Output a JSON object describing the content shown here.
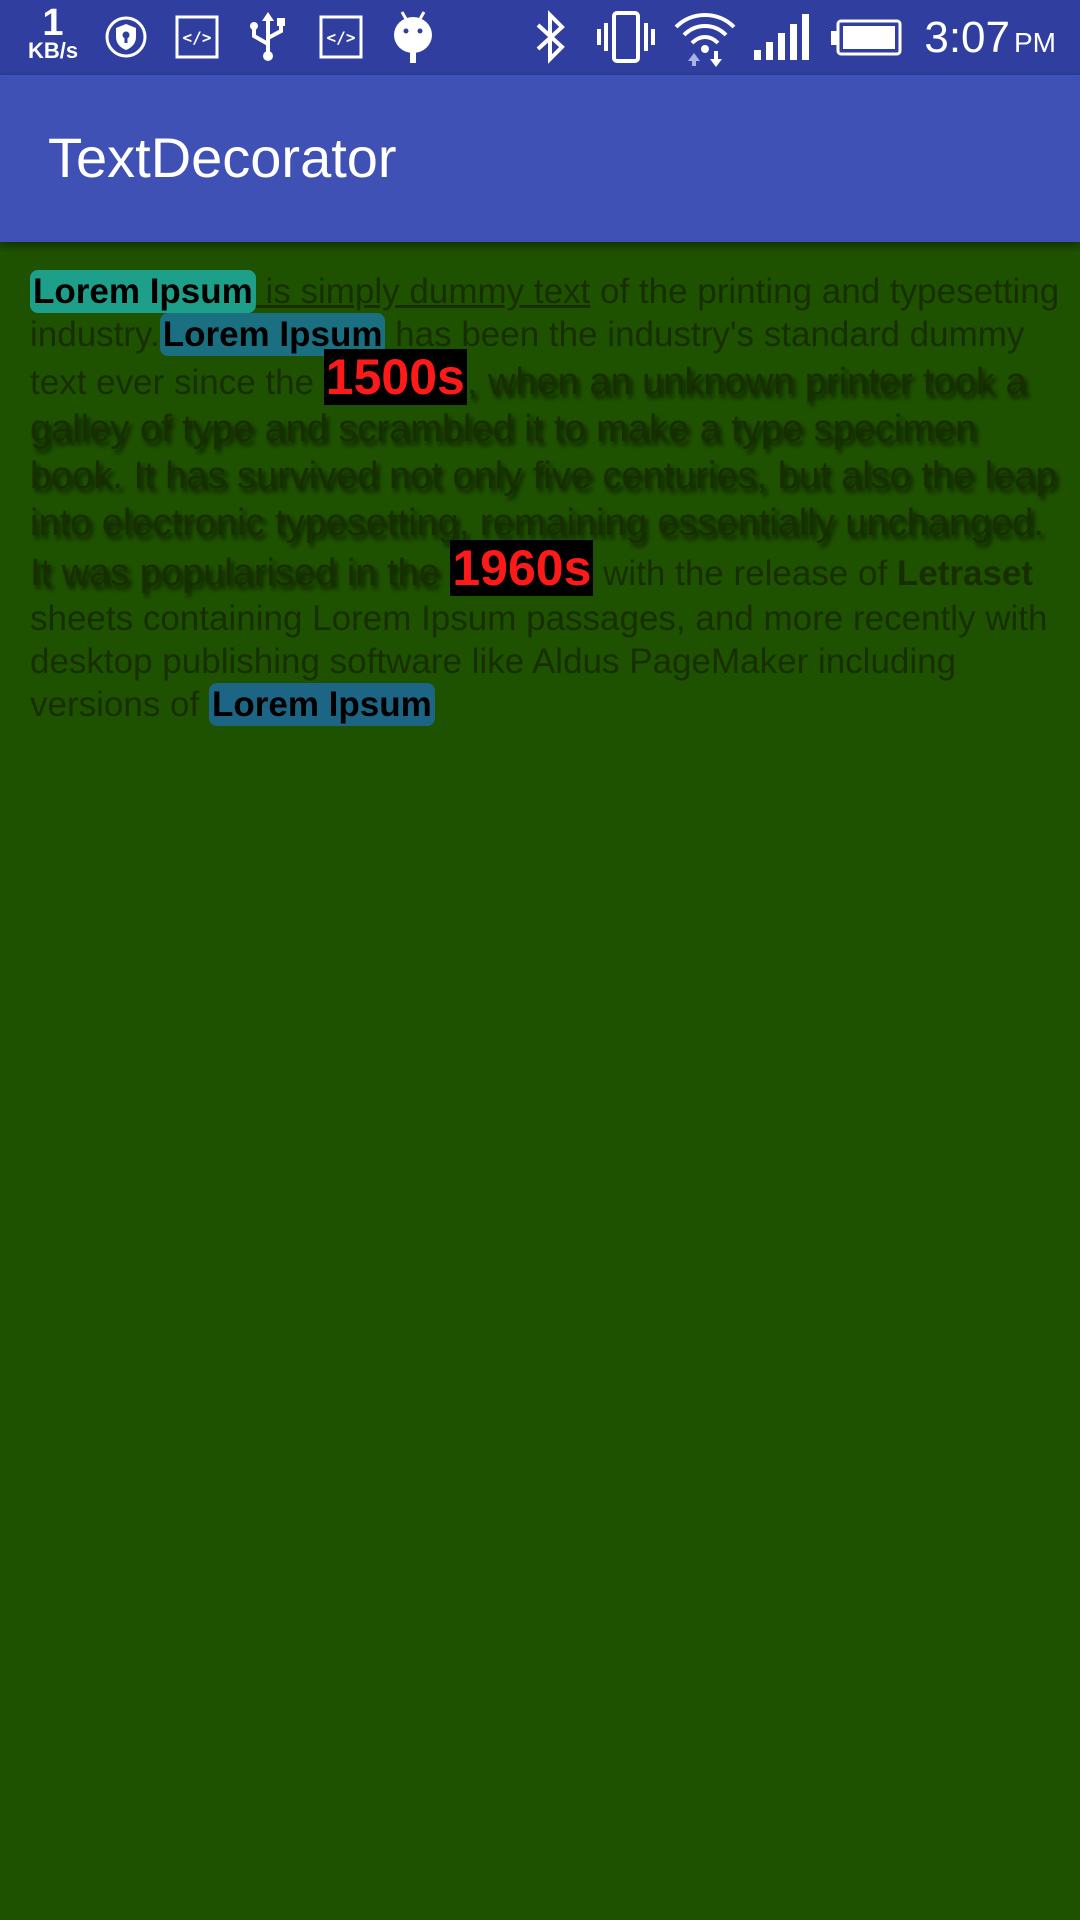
{
  "status_bar": {
    "net_speed_value": "1",
    "net_speed_unit": "KB/s",
    "time": "3:07",
    "ampm": "PM",
    "icons": [
      "shield-icon",
      "code-icon",
      "usb-icon",
      "code-icon",
      "android-icon",
      "bluetooth-icon",
      "vibrate-icon",
      "wifi-icon",
      "signal-icon",
      "battery-icon"
    ]
  },
  "app_bar": {
    "title": "TextDecorator"
  },
  "content": {
    "p1_tag": "Lorem Ipsum",
    "p1_underlined": " is simply dummy text",
    "p1_rest": " of the printing and typesetting industry.",
    "p2_tag": "Lorem Ipsum",
    "p2_rest": " has been the industry's standard dummy text ever since the ",
    "year_1500": "1500s",
    "shadow_text": ", when an unknown printer took a galley of type and scrambled it to make a type specimen book. It has survived not only five centuries, but also the leap into electronic typesetting, remaining essentially unchanged. It was popularised in the ",
    "year_1960": "1960s",
    "p3_a": " with the release of ",
    "p3_bold": "Letraset",
    "p3_b": " sheets containing Lorem Ipsum passages, and more recently with desktop publishing software like Aldus PageMaker including versions of ",
    "p3_tag": "Lorem Ipsum"
  },
  "colors": {
    "status_bar": "#303f9f",
    "app_bar": "#3f51b5",
    "background": "#1f5200",
    "year_text": "#ff1a1a"
  }
}
